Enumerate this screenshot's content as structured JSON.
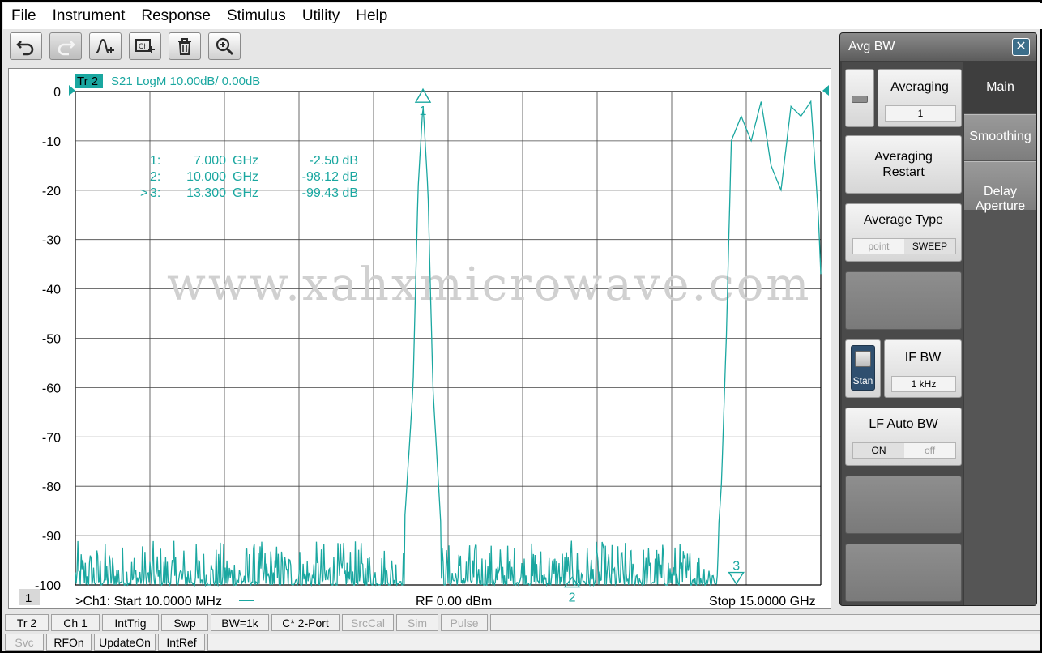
{
  "menu": [
    "File",
    "Instrument",
    "Response",
    "Stimulus",
    "Utility",
    "Help"
  ],
  "toolbar": {
    "buttons": [
      {
        "icon": "undo-icon",
        "enabled": true
      },
      {
        "icon": "redo-icon",
        "enabled": false
      },
      {
        "icon": "add-trace-icon",
        "enabled": true
      },
      {
        "icon": "add-channel-icon",
        "enabled": true
      },
      {
        "icon": "delete-icon",
        "enabled": true
      },
      {
        "icon": "zoom-icon",
        "enabled": true
      }
    ]
  },
  "trace": {
    "id": "Tr 2",
    "label": "S21 LogM 10.00dB/  0.00dB",
    "color": "#1aa7a0",
    "channel_number": "1"
  },
  "markers": [
    {
      "num": "1:",
      "freq": "7.000",
      "unit": "GHz",
      "value": "-2.50 dB",
      "active": false
    },
    {
      "num": "2:",
      "freq": "10.000",
      "unit": "GHz",
      "value": "-98.12 dB",
      "active": false
    },
    {
      "num": "3:",
      "freq": "13.300",
      "unit": "GHz",
      "value": "-99.43 dB",
      "active": true
    }
  ],
  "marker_tags": [
    "1",
    "2",
    "3"
  ],
  "footer": {
    "start": ">Ch1:  Start   10.0000 MHz",
    "rf": "RF    0.00 dBm",
    "stop": "Stop  15.0000 GHz"
  },
  "watermark": "www.xahxmicrowave.com",
  "chart_data": {
    "type": "line",
    "title": "",
    "xlabel": "",
    "ylabel": "",
    "xlim": [
      0.01,
      15.0
    ],
    "ylim": [
      -100,
      0
    ],
    "yticks": [
      "0",
      "-10",
      "-20",
      "-30",
      "-40",
      "-50",
      "-60",
      "-70",
      "-80",
      "-90",
      "-100"
    ],
    "grid": true,
    "series": [
      {
        "noise_floor_db": -99.5,
        "x_ghz": [
          0.01,
          6.4,
          6.6,
          6.8,
          6.9,
          7.0,
          7.1,
          7.2,
          7.4,
          7.6,
          12.8,
          12.9,
          13.0,
          13.1,
          13.2,
          13.4,
          13.6,
          13.8,
          14.0,
          14.2,
          14.4,
          14.6,
          14.8,
          14.95,
          15.0
        ],
        "y_db": [
          -99,
          -99,
          -92,
          -60,
          -20,
          -2.5,
          -20,
          -60,
          -95,
          -99,
          -99,
          -95,
          -80,
          -50,
          -10,
          -5,
          -10,
          -2,
          -15,
          -20,
          -3,
          -5,
          -2,
          -25,
          -37
        ]
      }
    ],
    "markers_ghz": [
      7.0,
      10.0,
      13.3
    ]
  },
  "side_panel": {
    "title": "Avg BW",
    "close_icon": "close-icon",
    "averaging": {
      "label": "Averaging",
      "value": "1"
    },
    "averaging_restart": "Averaging\nRestart",
    "average_type": {
      "label": "Average Type",
      "options": [
        "point",
        "SWEEP"
      ],
      "selected": "SWEEP"
    },
    "if_bw": {
      "label": "IF BW",
      "value": "1 kHz",
      "toggle": "Stan"
    },
    "lf_auto_bw": {
      "label": "LF Auto BW",
      "options": [
        "ON",
        "off"
      ],
      "selected": "ON"
    },
    "tabs": [
      "Main",
      "Smoothing",
      "Delay\nAperture"
    ]
  },
  "status_row1": [
    {
      "label": "Tr 2",
      "dim": false
    },
    {
      "label": "Ch 1",
      "dim": false
    },
    {
      "label": "IntTrig",
      "dim": false
    },
    {
      "label": "Swp",
      "dim": false
    },
    {
      "label": "BW=1k",
      "dim": false
    },
    {
      "label": "C* 2-Port",
      "dim": false
    },
    {
      "label": "SrcCal",
      "dim": true
    },
    {
      "label": "Sim",
      "dim": true
    },
    {
      "label": "Pulse",
      "dim": true
    }
  ],
  "status_row2": [
    {
      "label": "Svc",
      "dim": true
    },
    {
      "label": "RFOn",
      "dim": false
    },
    {
      "label": "UpdateOn",
      "dim": false
    },
    {
      "label": "IntRef",
      "dim": false
    }
  ]
}
